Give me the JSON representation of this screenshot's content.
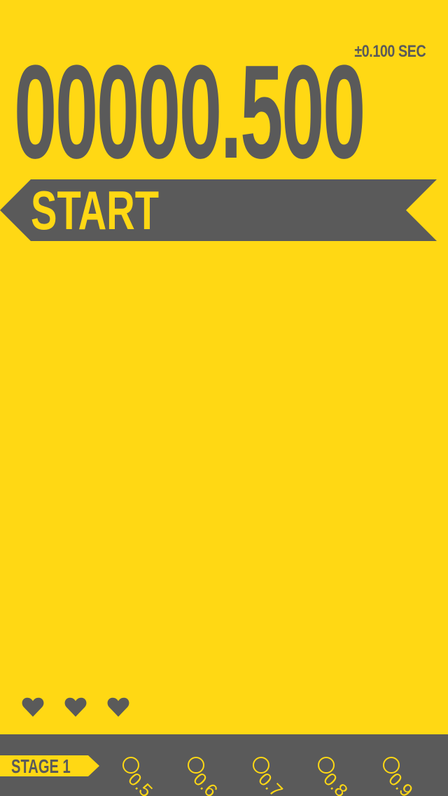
{
  "game": {
    "tolerance": "±0.100 SEC",
    "timer": "00000.500",
    "start_label": "START",
    "lives": {
      "count": 3,
      "icon": "heart-icon"
    },
    "stage": {
      "label": "STAGE 1",
      "nodes": [
        {
          "label": "0.5",
          "icon": "circle-icon"
        },
        {
          "label": "0.6",
          "icon": "circle-icon"
        },
        {
          "label": "0.7",
          "icon": "circle-icon"
        },
        {
          "label": "0.8",
          "icon": "circle-icon"
        },
        {
          "label": "0.9",
          "icon": "circle-icon"
        }
      ]
    }
  },
  "colors": {
    "background": "#FFD814",
    "foreground": "#5A5A5A"
  }
}
